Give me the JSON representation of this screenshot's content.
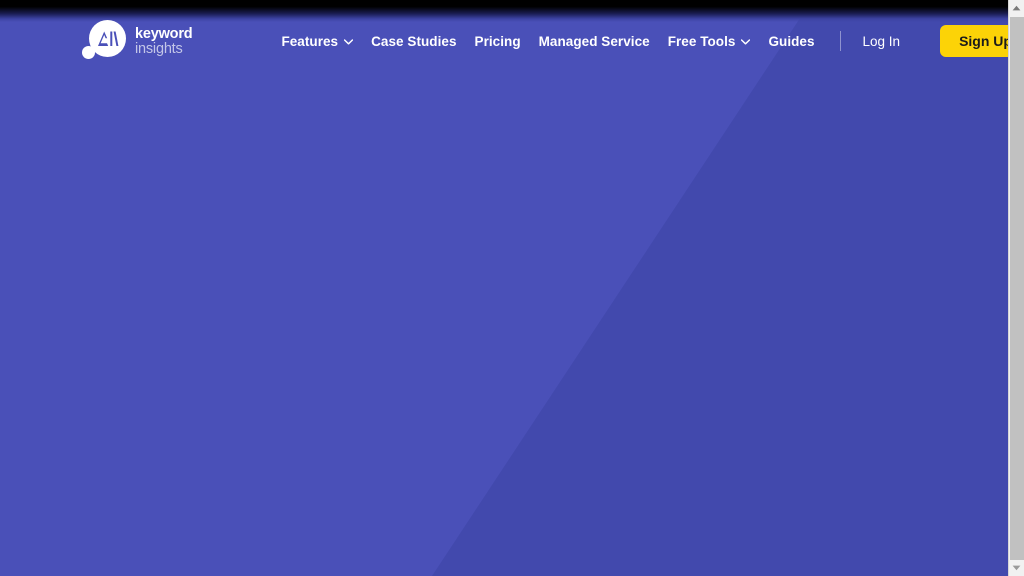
{
  "brand": {
    "name_line1": "keyword",
    "name_line2": "insights",
    "logo_icon": "ai-monogram-circle-icon",
    "logo_dot_icon": "brand-dot-icon",
    "accent_color": "#fcd307",
    "background_light": "#4a50b8",
    "background_dark": "#4249ad"
  },
  "header": {
    "nav": [
      {
        "label": "Features",
        "has_dropdown": true,
        "icon": "chevron-down-icon"
      },
      {
        "label": "Case Studies",
        "has_dropdown": false,
        "icon": ""
      },
      {
        "label": "Pricing",
        "has_dropdown": false,
        "icon": ""
      },
      {
        "label": "Managed Service",
        "has_dropdown": false,
        "icon": ""
      },
      {
        "label": "Free Tools",
        "has_dropdown": true,
        "icon": "chevron-down-icon"
      },
      {
        "label": "Guides",
        "has_dropdown": false,
        "icon": ""
      }
    ],
    "login_label": "Log In",
    "signup_label": "Sign Up"
  },
  "scrollbar": {
    "up_arrow_icon": "scroll-up-arrow-icon",
    "down_arrow_icon": "scroll-down-arrow-icon",
    "thumb_label": "vertical-scroll-thumb"
  }
}
